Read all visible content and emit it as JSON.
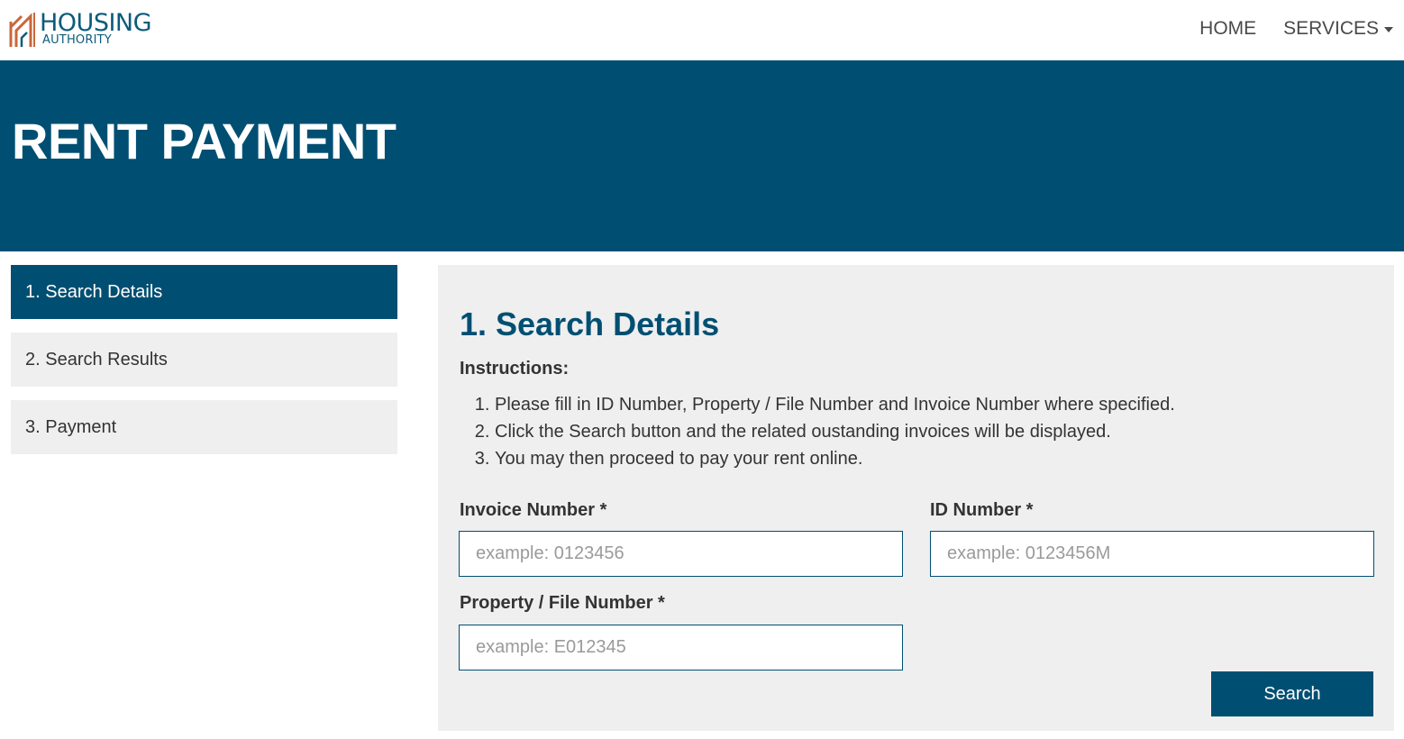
{
  "brand": {
    "line1": "HOUSING",
    "line2": "AUTHORITY",
    "accent_color": "#c8673a",
    "primary_color": "#004f72"
  },
  "nav": {
    "home_label": "HOME",
    "services_label": "SERVICES"
  },
  "hero": {
    "title": "RENT PAYMENT"
  },
  "steps": [
    {
      "label": "1. Search Details",
      "active": true
    },
    {
      "label": "2. Search Results",
      "active": false
    },
    {
      "label": "3. Payment",
      "active": false
    }
  ],
  "form": {
    "title": "1. Search Details",
    "instructions_heading": "Instructions:",
    "instructions": [
      "Please fill in ID Number, Property / File Number and Invoice Number where specified.",
      "Click the Search button and the related oustanding invoices will be displayed.",
      "You may then proceed to pay your rent online."
    ],
    "invoice_label": "Invoice Number *",
    "invoice_placeholder": "example: 0123456",
    "invoice_value": "",
    "id_label": "ID Number *",
    "id_placeholder": "example: 0123456M",
    "id_value": "",
    "property_label": "Property / File Number *",
    "property_placeholder": "example: E012345",
    "property_value": "",
    "search_label": "Search"
  }
}
